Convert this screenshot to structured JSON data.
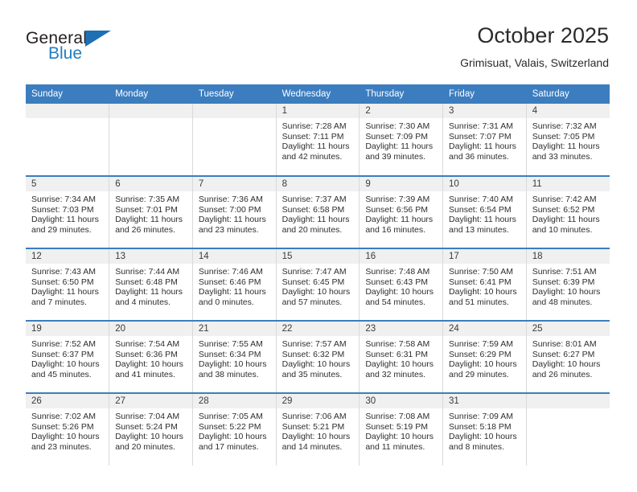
{
  "brand": {
    "name_top": "General",
    "name_bottom": "Blue",
    "accent_color": "#1f7ec4",
    "triangle_color": "#1f6fb4"
  },
  "header": {
    "title": "October 2025",
    "subtitle": "Grimisuat, Valais, Switzerland"
  },
  "theme": {
    "header_band": "#3c7dbf",
    "daynum_band": "#f0f0f0",
    "cell_border": "#d9d9d9"
  },
  "calendar": {
    "weekday_headers": [
      "Sunday",
      "Monday",
      "Tuesday",
      "Wednesday",
      "Thursday",
      "Friday",
      "Saturday"
    ],
    "weeks": [
      [
        {
          "day": "",
          "empty": true,
          "sunrise": "",
          "sunset": "",
          "daylight_1": "",
          "daylight_2": ""
        },
        {
          "day": "",
          "empty": true,
          "sunrise": "",
          "sunset": "",
          "daylight_1": "",
          "daylight_2": ""
        },
        {
          "day": "",
          "empty": true,
          "sunrise": "",
          "sunset": "",
          "daylight_1": "",
          "daylight_2": ""
        },
        {
          "day": "1",
          "empty": false,
          "sunrise": "Sunrise: 7:28 AM",
          "sunset": "Sunset: 7:11 PM",
          "daylight_1": "Daylight: 11 hours",
          "daylight_2": "and 42 minutes."
        },
        {
          "day": "2",
          "empty": false,
          "sunrise": "Sunrise: 7:30 AM",
          "sunset": "Sunset: 7:09 PM",
          "daylight_1": "Daylight: 11 hours",
          "daylight_2": "and 39 minutes."
        },
        {
          "day": "3",
          "empty": false,
          "sunrise": "Sunrise: 7:31 AM",
          "sunset": "Sunset: 7:07 PM",
          "daylight_1": "Daylight: 11 hours",
          "daylight_2": "and 36 minutes."
        },
        {
          "day": "4",
          "empty": false,
          "sunrise": "Sunrise: 7:32 AM",
          "sunset": "Sunset: 7:05 PM",
          "daylight_1": "Daylight: 11 hours",
          "daylight_2": "and 33 minutes."
        }
      ],
      [
        {
          "day": "5",
          "empty": false,
          "sunrise": "Sunrise: 7:34 AM",
          "sunset": "Sunset: 7:03 PM",
          "daylight_1": "Daylight: 11 hours",
          "daylight_2": "and 29 minutes."
        },
        {
          "day": "6",
          "empty": false,
          "sunrise": "Sunrise: 7:35 AM",
          "sunset": "Sunset: 7:01 PM",
          "daylight_1": "Daylight: 11 hours",
          "daylight_2": "and 26 minutes."
        },
        {
          "day": "7",
          "empty": false,
          "sunrise": "Sunrise: 7:36 AM",
          "sunset": "Sunset: 7:00 PM",
          "daylight_1": "Daylight: 11 hours",
          "daylight_2": "and 23 minutes."
        },
        {
          "day": "8",
          "empty": false,
          "sunrise": "Sunrise: 7:37 AM",
          "sunset": "Sunset: 6:58 PM",
          "daylight_1": "Daylight: 11 hours",
          "daylight_2": "and 20 minutes."
        },
        {
          "day": "9",
          "empty": false,
          "sunrise": "Sunrise: 7:39 AM",
          "sunset": "Sunset: 6:56 PM",
          "daylight_1": "Daylight: 11 hours",
          "daylight_2": "and 16 minutes."
        },
        {
          "day": "10",
          "empty": false,
          "sunrise": "Sunrise: 7:40 AM",
          "sunset": "Sunset: 6:54 PM",
          "daylight_1": "Daylight: 11 hours",
          "daylight_2": "and 13 minutes."
        },
        {
          "day": "11",
          "empty": false,
          "sunrise": "Sunrise: 7:42 AM",
          "sunset": "Sunset: 6:52 PM",
          "daylight_1": "Daylight: 11 hours",
          "daylight_2": "and 10 minutes."
        }
      ],
      [
        {
          "day": "12",
          "empty": false,
          "sunrise": "Sunrise: 7:43 AM",
          "sunset": "Sunset: 6:50 PM",
          "daylight_1": "Daylight: 11 hours",
          "daylight_2": "and 7 minutes."
        },
        {
          "day": "13",
          "empty": false,
          "sunrise": "Sunrise: 7:44 AM",
          "sunset": "Sunset: 6:48 PM",
          "daylight_1": "Daylight: 11 hours",
          "daylight_2": "and 4 minutes."
        },
        {
          "day": "14",
          "empty": false,
          "sunrise": "Sunrise: 7:46 AM",
          "sunset": "Sunset: 6:46 PM",
          "daylight_1": "Daylight: 11 hours",
          "daylight_2": "and 0 minutes."
        },
        {
          "day": "15",
          "empty": false,
          "sunrise": "Sunrise: 7:47 AM",
          "sunset": "Sunset: 6:45 PM",
          "daylight_1": "Daylight: 10 hours",
          "daylight_2": "and 57 minutes."
        },
        {
          "day": "16",
          "empty": false,
          "sunrise": "Sunrise: 7:48 AM",
          "sunset": "Sunset: 6:43 PM",
          "daylight_1": "Daylight: 10 hours",
          "daylight_2": "and 54 minutes."
        },
        {
          "day": "17",
          "empty": false,
          "sunrise": "Sunrise: 7:50 AM",
          "sunset": "Sunset: 6:41 PM",
          "daylight_1": "Daylight: 10 hours",
          "daylight_2": "and 51 minutes."
        },
        {
          "day": "18",
          "empty": false,
          "sunrise": "Sunrise: 7:51 AM",
          "sunset": "Sunset: 6:39 PM",
          "daylight_1": "Daylight: 10 hours",
          "daylight_2": "and 48 minutes."
        }
      ],
      [
        {
          "day": "19",
          "empty": false,
          "sunrise": "Sunrise: 7:52 AM",
          "sunset": "Sunset: 6:37 PM",
          "daylight_1": "Daylight: 10 hours",
          "daylight_2": "and 45 minutes."
        },
        {
          "day": "20",
          "empty": false,
          "sunrise": "Sunrise: 7:54 AM",
          "sunset": "Sunset: 6:36 PM",
          "daylight_1": "Daylight: 10 hours",
          "daylight_2": "and 41 minutes."
        },
        {
          "day": "21",
          "empty": false,
          "sunrise": "Sunrise: 7:55 AM",
          "sunset": "Sunset: 6:34 PM",
          "daylight_1": "Daylight: 10 hours",
          "daylight_2": "and 38 minutes."
        },
        {
          "day": "22",
          "empty": false,
          "sunrise": "Sunrise: 7:57 AM",
          "sunset": "Sunset: 6:32 PM",
          "daylight_1": "Daylight: 10 hours",
          "daylight_2": "and 35 minutes."
        },
        {
          "day": "23",
          "empty": false,
          "sunrise": "Sunrise: 7:58 AM",
          "sunset": "Sunset: 6:31 PM",
          "daylight_1": "Daylight: 10 hours",
          "daylight_2": "and 32 minutes."
        },
        {
          "day": "24",
          "empty": false,
          "sunrise": "Sunrise: 7:59 AM",
          "sunset": "Sunset: 6:29 PM",
          "daylight_1": "Daylight: 10 hours",
          "daylight_2": "and 29 minutes."
        },
        {
          "day": "25",
          "empty": false,
          "sunrise": "Sunrise: 8:01 AM",
          "sunset": "Sunset: 6:27 PM",
          "daylight_1": "Daylight: 10 hours",
          "daylight_2": "and 26 minutes."
        }
      ],
      [
        {
          "day": "26",
          "empty": false,
          "sunrise": "Sunrise: 7:02 AM",
          "sunset": "Sunset: 5:26 PM",
          "daylight_1": "Daylight: 10 hours",
          "daylight_2": "and 23 minutes."
        },
        {
          "day": "27",
          "empty": false,
          "sunrise": "Sunrise: 7:04 AM",
          "sunset": "Sunset: 5:24 PM",
          "daylight_1": "Daylight: 10 hours",
          "daylight_2": "and 20 minutes."
        },
        {
          "day": "28",
          "empty": false,
          "sunrise": "Sunrise: 7:05 AM",
          "sunset": "Sunset: 5:22 PM",
          "daylight_1": "Daylight: 10 hours",
          "daylight_2": "and 17 minutes."
        },
        {
          "day": "29",
          "empty": false,
          "sunrise": "Sunrise: 7:06 AM",
          "sunset": "Sunset: 5:21 PM",
          "daylight_1": "Daylight: 10 hours",
          "daylight_2": "and 14 minutes."
        },
        {
          "day": "30",
          "empty": false,
          "sunrise": "Sunrise: 7:08 AM",
          "sunset": "Sunset: 5:19 PM",
          "daylight_1": "Daylight: 10 hours",
          "daylight_2": "and 11 minutes."
        },
        {
          "day": "31",
          "empty": false,
          "sunrise": "Sunrise: 7:09 AM",
          "sunset": "Sunset: 5:18 PM",
          "daylight_1": "Daylight: 10 hours",
          "daylight_2": "and 8 minutes."
        },
        {
          "day": "",
          "empty": true,
          "sunrise": "",
          "sunset": "",
          "daylight_1": "",
          "daylight_2": ""
        }
      ]
    ]
  }
}
